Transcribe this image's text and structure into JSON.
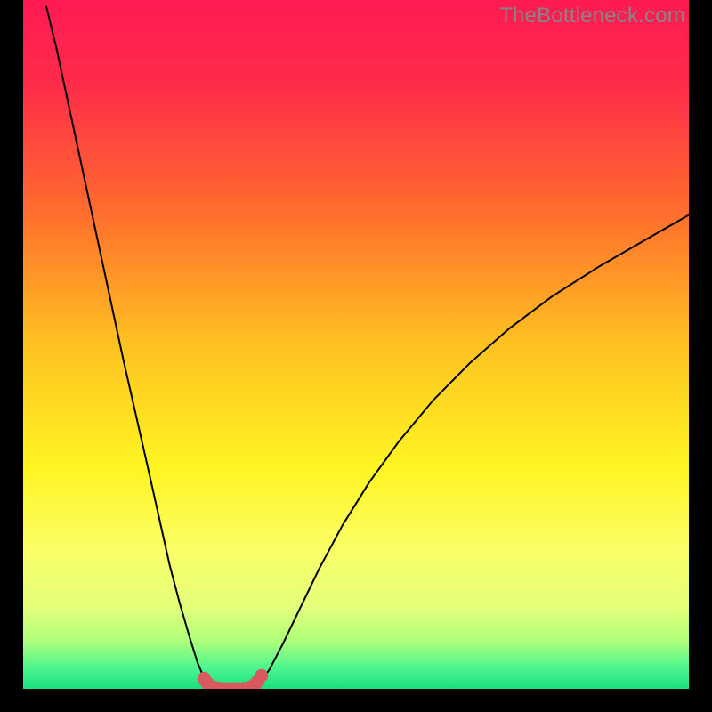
{
  "watermark": "TheBottleneck.com",
  "chart_data": {
    "type": "line",
    "title": "",
    "xlabel": "",
    "ylabel": "",
    "xlim": [
      0,
      100
    ],
    "ylim": [
      0,
      100
    ],
    "gradient_stops": [
      {
        "offset": 0.0,
        "color": "#ff1a52"
      },
      {
        "offset": 0.12,
        "color": "#ff2b4a"
      },
      {
        "offset": 0.3,
        "color": "#ff6a2e"
      },
      {
        "offset": 0.5,
        "color": "#ffc221"
      },
      {
        "offset": 0.68,
        "color": "#fff522"
      },
      {
        "offset": 0.8,
        "color": "#faff68"
      },
      {
        "offset": 0.88,
        "color": "#e4ff7a"
      },
      {
        "offset": 0.93,
        "color": "#b0ff7a"
      },
      {
        "offset": 0.97,
        "color": "#4cf58f"
      },
      {
        "offset": 1.0,
        "color": "#18e07e"
      }
    ],
    "series": [
      {
        "name": "left-branch",
        "color": "#000000",
        "x": [
          3.5,
          5,
          7,
          9,
          11,
          13,
          15,
          17,
          19,
          20.5,
          22,
          23.5,
          25,
          26.2,
          27.2,
          28,
          28.8
        ],
        "y": [
          99,
          93,
          84,
          75,
          66,
          57,
          48,
          39.5,
          31,
          24.5,
          18,
          12.5,
          7.5,
          3.8,
          1.5,
          0.4,
          0.05
        ]
      },
      {
        "name": "valley-floor",
        "color": "#000000",
        "x": [
          28.8,
          30,
          31.5,
          33,
          34.3
        ],
        "y": [
          0.05,
          0.0,
          0.0,
          0.0,
          0.05
        ]
      },
      {
        "name": "right-branch",
        "color": "#000000",
        "x": [
          34.3,
          35.5,
          37,
          39,
          41.5,
          44.5,
          48,
          52,
          56.5,
          61.5,
          67,
          73,
          79.5,
          86.5,
          93.5,
          100
        ],
        "y": [
          0.05,
          0.8,
          2.8,
          6.5,
          11.5,
          17.5,
          23.8,
          30,
          36,
          41.8,
          47.2,
          52.3,
          57,
          61.3,
          65.2,
          68.8
        ]
      },
      {
        "name": "highlight-markers",
        "color": "#d85a5f",
        "type": "scatter-line",
        "marker_radius": 1.0,
        "stroke_width": 1.8,
        "x": [
          27.2,
          27.6,
          28.0,
          28.5,
          29.1,
          29.8,
          30.6,
          31.5,
          32.3,
          33.1,
          33.8,
          34.4,
          34.9,
          35.3,
          35.8
        ],
        "y": [
          1.5,
          0.9,
          0.5,
          0.25,
          0.1,
          0.03,
          0.0,
          0.0,
          0.0,
          0.03,
          0.12,
          0.35,
          0.7,
          1.2,
          1.9
        ]
      }
    ]
  }
}
